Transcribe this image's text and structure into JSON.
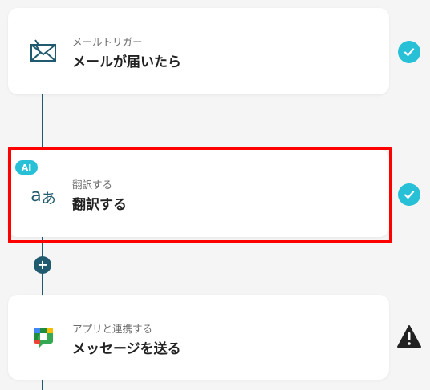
{
  "steps": [
    {
      "subtitle": "メールトリガー",
      "title": "メールが届いたら",
      "icon": "mail-icon",
      "status": "complete"
    },
    {
      "badge": "AI",
      "subtitle": "翻訳する",
      "title": "翻訳する",
      "icon": "translate-icon",
      "status": "complete"
    },
    {
      "subtitle": "アプリと連携する",
      "title": "メッセージを送る",
      "icon": "google-chat-icon",
      "status": "warning"
    }
  ],
  "add_step": {
    "symbol": "+"
  },
  "colors": {
    "accent": "#27c0d6",
    "connector": "#1f5a6e",
    "selected": "#ff0000",
    "warning": "#222222"
  }
}
